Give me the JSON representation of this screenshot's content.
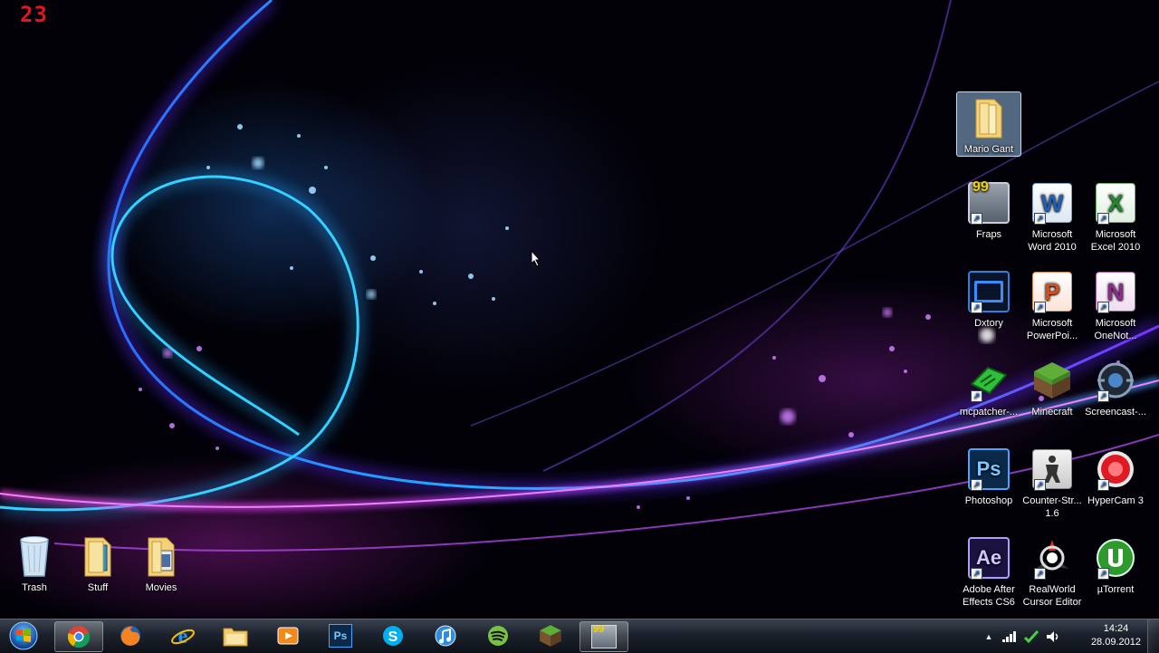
{
  "overlay": {
    "fps_counter": "23"
  },
  "desktop": {
    "left_icons": [
      {
        "label": "Trash",
        "icon": "recycle-bin-icon"
      },
      {
        "label": "Stuff",
        "icon": "folder-icon"
      },
      {
        "label": "Movies",
        "icon": "folder-icon"
      }
    ],
    "right_icons": [
      {
        "label": "Mario Gant",
        "icon": "folder-icon",
        "selected": true
      },
      {
        "label": "Fraps",
        "icon": "fraps-icon"
      },
      {
        "label": "Microsoft Word 2010",
        "icon": "word-icon"
      },
      {
        "label": "Microsoft Excel 2010",
        "icon": "excel-icon"
      },
      {
        "label": "Dxtory",
        "icon": "dxtory-icon"
      },
      {
        "label": "Microsoft PowerPoi...",
        "icon": "powerpoint-icon"
      },
      {
        "label": "Microsoft OneNot...",
        "icon": "onenote-icon"
      },
      {
        "label": "mcpatcher-...",
        "icon": "mcpatcher-icon"
      },
      {
        "label": "Minecraft",
        "icon": "minecraft-icon"
      },
      {
        "label": "Screencast-...",
        "icon": "screencast-icon"
      },
      {
        "label": "Photoshop",
        "icon": "photoshop-icon"
      },
      {
        "label": "Counter-Str... 1.6",
        "icon": "counter-strike-icon"
      },
      {
        "label": "HyperCam 3",
        "icon": "hypercam-icon"
      },
      {
        "label": "Adobe After Effects CS6",
        "icon": "after-effects-icon"
      },
      {
        "label": "RealWorld Cursor Editor",
        "icon": "realworld-icon"
      },
      {
        "label": "µTorrent",
        "icon": "utorrent-icon"
      }
    ],
    "tile_text": {
      "fraps": "99",
      "word": "W",
      "excel": "X",
      "powerpoint": "P",
      "onenote": "N",
      "photoshop": "Ps",
      "after_effects": "Ae",
      "taskbar_photoshop": "Ps",
      "taskbar_fraps": "99"
    }
  },
  "taskbar": {
    "start_icon": "windows-orb-icon",
    "pinned": [
      {
        "icon": "chrome-icon",
        "active": true
      },
      {
        "icon": "firefox-icon"
      },
      {
        "icon": "internet-explorer-icon"
      },
      {
        "icon": "explorer-folder-icon"
      },
      {
        "icon": "media-player-icon"
      },
      {
        "icon": "photoshop-icon"
      },
      {
        "icon": "skype-icon"
      },
      {
        "icon": "itunes-icon"
      },
      {
        "icon": "spotify-icon"
      },
      {
        "icon": "minecraft-icon"
      },
      {
        "icon": "fraps-icon",
        "active": true
      }
    ],
    "tray": {
      "icons": [
        "show-hidden-icons-chevron",
        "signal-icon",
        "network-icon",
        "volume-icon"
      ],
      "chevron": "▲",
      "time": "14:24",
      "date": "28.09.2012"
    }
  },
  "colors": {
    "accent_purple": "#a020f0",
    "accent_cyan": "#18b8ff",
    "fps_red": "#e8141c"
  }
}
